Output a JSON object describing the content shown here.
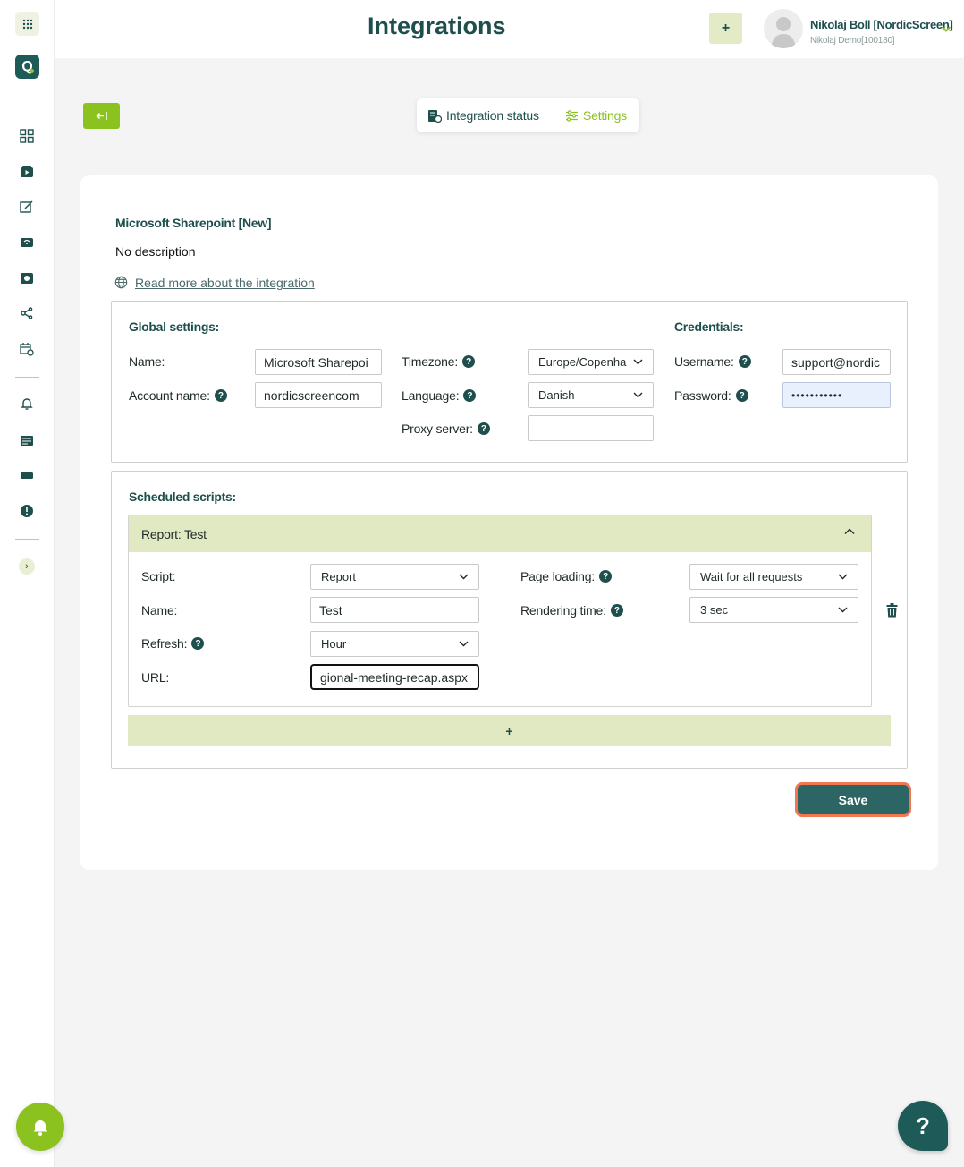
{
  "header": {
    "title": "Integrations",
    "add_label": "+",
    "user_name": "Nikolaj Boll [NordicScreen]",
    "user_account": "Nikolaj Demo[100180]"
  },
  "tabs": {
    "status_label": "Integration status",
    "settings_label": "Settings"
  },
  "integration": {
    "title": "Microsoft Sharepoint [New]",
    "description": "No description",
    "read_more": "Read more about the integration"
  },
  "global": {
    "heading": "Global settings:",
    "name_label": "Name:",
    "name_value": "Microsoft Sharepoi",
    "account_label": "Account name:",
    "account_value": "nordicscreencom",
    "timezone_label": "Timezone:",
    "timezone_value": "Europe/Copenha",
    "language_label": "Language:",
    "language_value": "Danish",
    "proxy_label": "Proxy server:",
    "proxy_value": ""
  },
  "credentials": {
    "heading": "Credentials:",
    "username_label": "Username:",
    "username_value": "support@nordic",
    "password_label": "Password:",
    "password_value": "•••••••••••"
  },
  "scripts": {
    "heading": "Scheduled scripts:",
    "item_title": "Report: Test",
    "script_label": "Script:",
    "script_value": "Report",
    "name_label": "Name:",
    "name_value": "Test",
    "refresh_label": "Refresh:",
    "refresh_value": "Hour",
    "url_label": "URL:",
    "url_value": "gional-meeting-recap.aspx",
    "page_loading_label": "Page loading:",
    "page_loading_value": "Wait for all requests",
    "rendering_label": "Rendering time:",
    "rendering_value": "3 sec",
    "add_label": "+"
  },
  "actions": {
    "save_label": "Save",
    "help_label": "?"
  },
  "colors": {
    "brand_dark": "#1e4f4d",
    "accent_green": "#8cc21f",
    "save_bg": "#2d6565",
    "save_border": "#f07850",
    "panel_head": "#e1e9c2"
  }
}
